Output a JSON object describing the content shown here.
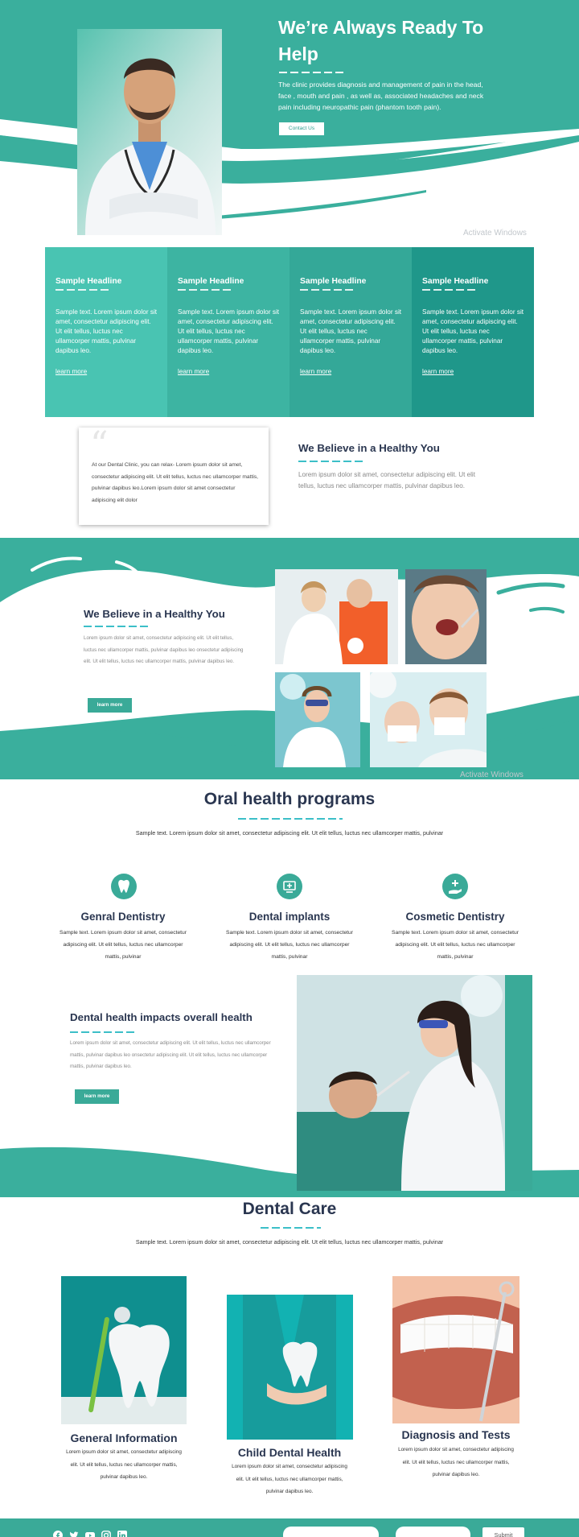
{
  "hero": {
    "title": "We’re Always Ready To Help",
    "text": "The clinic provides diagnosis and management of pain in the head, face , mouth and pain , as well as, associated headaches and neck pain including neuropathic pain (phantom tooth pain).",
    "button": "Contact Us",
    "watermark": "Activate Windows"
  },
  "features": [
    {
      "title": "Sample Headline",
      "text": "Sample text. Lorem ipsum dolor sit amet, consectetur adipiscing elit. Ut elit tellus, luctus nec ullamcorper mattis, pulvinar dapibus leo.",
      "link": "learn more",
      "color": "#49c4b2"
    },
    {
      "title": "Sample Headline",
      "text": "Sample text. Lorem ipsum dolor sit amet, consectetur adipiscing elit. Ut elit tellus, luctus nec ullamcorper mattis, pulvinar dapibus leo.",
      "link": "learn more",
      "color": "#3db4a2"
    },
    {
      "title": "Sample Headline",
      "text": "Sample text. Lorem ipsum dolor sit amet, consectetur adipiscing elit. Ut elit tellus, luctus nec ullamcorper mattis, pulvinar dapibus leo.",
      "link": "learn more",
      "color": "#34a898"
    },
    {
      "title": "Sample Headline",
      "text": "Sample text. Lorem ipsum dolor sit amet, consectetur adipiscing elit. Ut elit tellus, luctus nec ullamcorper mattis, pulvinar dapibus leo.",
      "link": "learn more",
      "color": "#1f978a"
    }
  ],
  "quote": {
    "mark": "“",
    "text": "At our Dental Clinic, you can relax- Lorem ipsum dolor sit amet, consectetur adipiscing elit. Ut elit tellus, luctus nec ullamcorper mattis, pulvinar dapibus leo.Lorem ipsum dolor sit amet consectetur adipiscing elit dolor"
  },
  "believe_top": {
    "title": "We Believe in a Healthy You",
    "text": "Lorem ipsum dolor sit amet, consectetur adipiscing elit. Ut elit tellus, luctus nec ullamcorper mattis, pulvinar dapibus leo."
  },
  "believe_band": {
    "title": "We Believe in a Healthy You",
    "text": "Lorem ipsum dolor sit amet, consectetur adipiscing elit. Ut elit tellus, luctus nec ullamcorper mattis, pulvinar dapibus leo onsectetur adipiscing elit. Ut elit tellus, luctus nec ullamcorper mattis, pulvinar dapibus leo.",
    "button": "learn more",
    "watermark": "Activate Windows"
  },
  "programs": {
    "title": "Oral health programs",
    "subtitle": "Sample text. Lorem ipsum dolor sit amet, consectetur adipiscing elit. Ut elit tellus, luctus nec ullamcorper mattis, pulvinar",
    "items": [
      {
        "icon": "tooth-icon",
        "title": "Genral Dentistry",
        "text": "Sample text. Lorem ipsum dolor sit amet, consectetur adipiscing elit. Ut elit tellus, luctus nec ullamcorper mattis, pulvinar"
      },
      {
        "icon": "monitor-plus-icon",
        "title": "Dental implants",
        "text": "Sample text. Lorem ipsum dolor sit amet, consectetur adipiscing elit. Ut elit tellus, luctus nec ullamcorper mattis, pulvinar"
      },
      {
        "icon": "hand-medical-icon",
        "title": "Cosmetic Dentistry",
        "text": "Sample text. Lorem ipsum dolor sit amet, consectetur adipiscing elit. Ut elit tellus, luctus nec ullamcorper mattis, pulvinar"
      }
    ]
  },
  "impact": {
    "title": "Dental health impacts overall health",
    "text": "Lorem ipsum dolor sit amet, consectetur adipiscing elit. Ut elit tellus, luctus nec ullamcorper mattis, pulvinar dapibus leo onsectetur adipiscing elit. Ut elit tellus, luctus nec ullamcorper mattis, pulvinar dapibus leo.",
    "button": "learn more"
  },
  "care": {
    "title": "Dental Care",
    "subtitle": "Sample text. Lorem ipsum dolor sit amet, consectetur adipiscing elit. Ut elit tellus, luctus nec ullamcorper mattis, pulvinar",
    "items": [
      {
        "title": "General Information",
        "text": "Lorem ipsum dolor sit amet, consectetur adipiscing elit. Ut elit tellus, luctus nec ullamcorper mattis, pulvinar dapibus leo."
      },
      {
        "title": "Child Dental Health",
        "text": "Lorem ipsum dolor sit amet, consectetur adipiscing elit. Ut elit tellus, luctus nec ullamcorper mattis, pulvinar dapibus leo."
      },
      {
        "title": "Diagnosis and Tests",
        "text": "Lorem ipsum dolor sit amet, consectetur adipiscing elit. Ut elit tellus, luctus nec ullamcorper mattis, pulvinar dapibus leo."
      }
    ]
  },
  "footer": {
    "social_icons": [
      "facebook-icon",
      "twitter-icon",
      "youtube-icon",
      "instagram-icon",
      "linkedin-icon"
    ],
    "submit": "Submit"
  },
  "colors": {
    "teal": "#3aaa98",
    "teal_dark": "#1f978a",
    "navy": "#2a3650"
  }
}
